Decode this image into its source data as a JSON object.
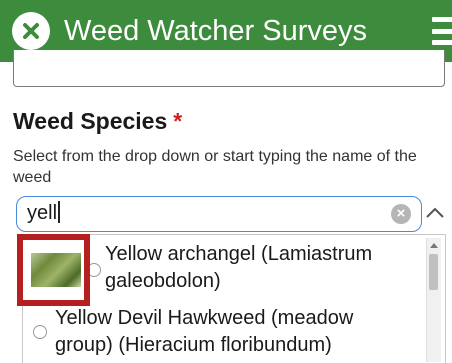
{
  "header": {
    "title": "Weed Watcher Surveys",
    "close_icon": "close-icon",
    "menu_icon": "hamburger-menu-icon",
    "background_color": "#3d8c3d"
  },
  "field": {
    "label": "Weed Species",
    "required_mark": "*",
    "hint": "Select from the drop down or start typing the name of the weed",
    "search_value": "yell",
    "clear_icon": "clear-icon",
    "collapse_icon": "chevron-up-icon"
  },
  "options": [
    {
      "line1": "Yellow archangel (Lamiastrum",
      "line2": "galeobdolon)",
      "has_thumbnail": true
    },
    {
      "line1": "Yellow Devil Hawkweed (meadow",
      "line2": "group) (Hieracium floribundum)",
      "has_thumbnail": false
    }
  ],
  "colors": {
    "accent": "#3d8c3d",
    "highlight": "#b51f1f",
    "required": "#cc1f1f",
    "focus_border": "#4a88d9"
  }
}
